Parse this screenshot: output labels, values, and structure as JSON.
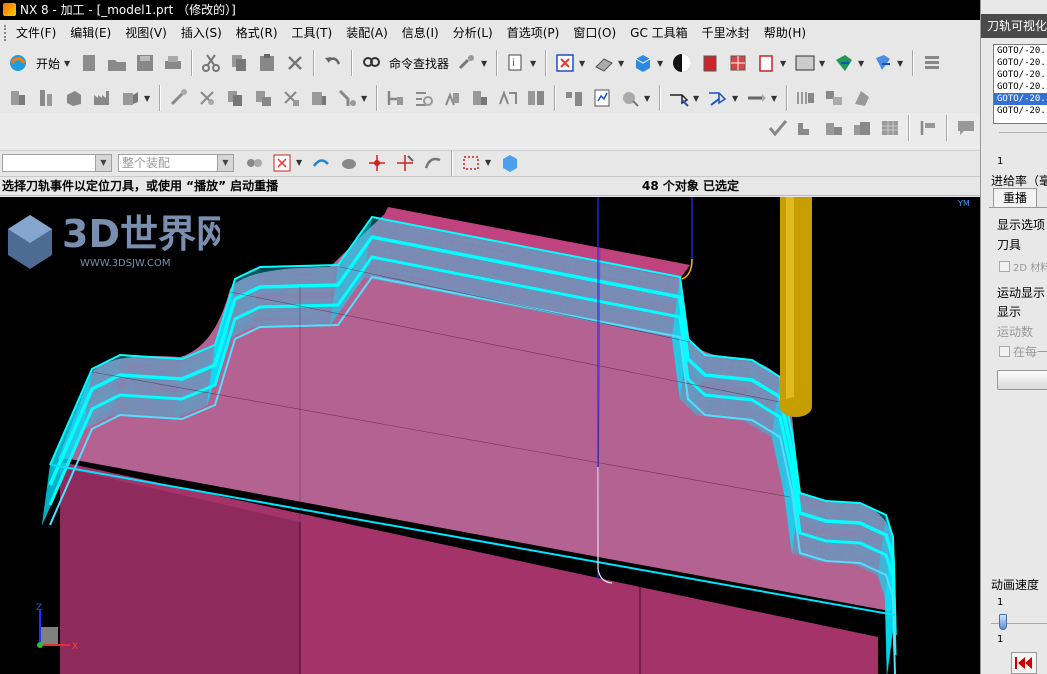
{
  "window": {
    "title": "NX 8 - 加工 - [_model1.prt （修改的）]"
  },
  "menu": {
    "items": [
      "文件(F)",
      "编辑(E)",
      "视图(V)",
      "插入(S)",
      "格式(R)",
      "工具(T)",
      "装配(A)",
      "信息(I)",
      "分析(L)",
      "首选项(P)",
      "窗口(O)",
      "GC 工具箱",
      "千里冰封",
      "帮助(H)"
    ]
  },
  "toolbar": {
    "start_label": "开始",
    "command_finder_label": "命令查找器"
  },
  "selection_bar": {
    "filter_value": "",
    "scope_value": "整个装配"
  },
  "status": {
    "prompt": "选择刀轨事件以定位刀具，或使用 “播放” 启动重播",
    "selection_count": "48 个对象  已选定"
  },
  "viewport": {
    "triad_labels": [
      "Z",
      "X"
    ],
    "corner_label": "YM"
  },
  "panel": {
    "title": "刀轨可视化",
    "path_lines": [
      "GOTO/-20.",
      "GOTO/-20.",
      "GOTO/-20.",
      "GOTO/-20.",
      "GOTO/-20.",
      "GOTO/-20."
    ],
    "selected_line_index": 4,
    "scroll_value": "1",
    "feed_rate_label": "进给率（毫",
    "tab_replay": "重播",
    "display_options_label": "显示选项",
    "tool_label": "刀具",
    "check_2d_label": "2D 材料",
    "motion_display_label": "运动显示",
    "display_label": "显示",
    "motion_count_label": "运动数",
    "check_each_label": "在每一",
    "anim_speed_label": "动画速度",
    "slider_min": "1",
    "slider_value": "1"
  },
  "watermark": {
    "text": "3D世界网",
    "url": "WWW.3DSJW.COM"
  },
  "colors": {
    "part": "#a4336a",
    "toolpath": "#00e5ff",
    "tool": "#d4a800",
    "axis": "#2030ff",
    "panel_title_bg": "#4a4a4a",
    "selected": "#3470d2"
  }
}
